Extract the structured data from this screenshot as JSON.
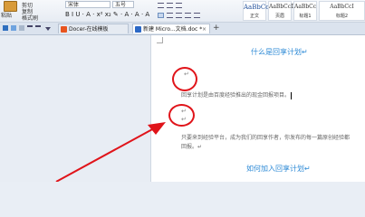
{
  "ribbon": {
    "paste_label": "粘贴",
    "cut_label": "剪切",
    "copy_label": "复制",
    "format_painter_label": "格式刷",
    "font_name": "宋体",
    "font_size": "五号",
    "format_buttons": "B I U · A · x² x₂ ✎ · A · A · A",
    "styles": [
      {
        "sample": "AaBbCcDd",
        "name": "正文"
      },
      {
        "sample": "AaBbCcDd",
        "name": "页眉"
      },
      {
        "sample": "AaBbCc",
        "name": "标题1"
      },
      {
        "sample": "AaBbCcI",
        "name": "标题2"
      }
    ]
  },
  "tabs": {
    "docer_label": "Docer-在线模板",
    "doc_label": "新建 Micro...文档.doc *",
    "add_label": "+"
  },
  "document": {
    "heading1": "什么是回享计划",
    "para1": "回享计划是由百度经验推出的现金回报项目。",
    "para2_line1": "只要来到经验平台，成为我们的回享作者，你发布的每一篇原创经验都",
    "para2_line2": "回报。",
    "heading2": "如何加入回享计划",
    "return_mark": "↵"
  },
  "colors": {
    "annotation": "#e0141a",
    "heading": "#2d8ad6"
  }
}
